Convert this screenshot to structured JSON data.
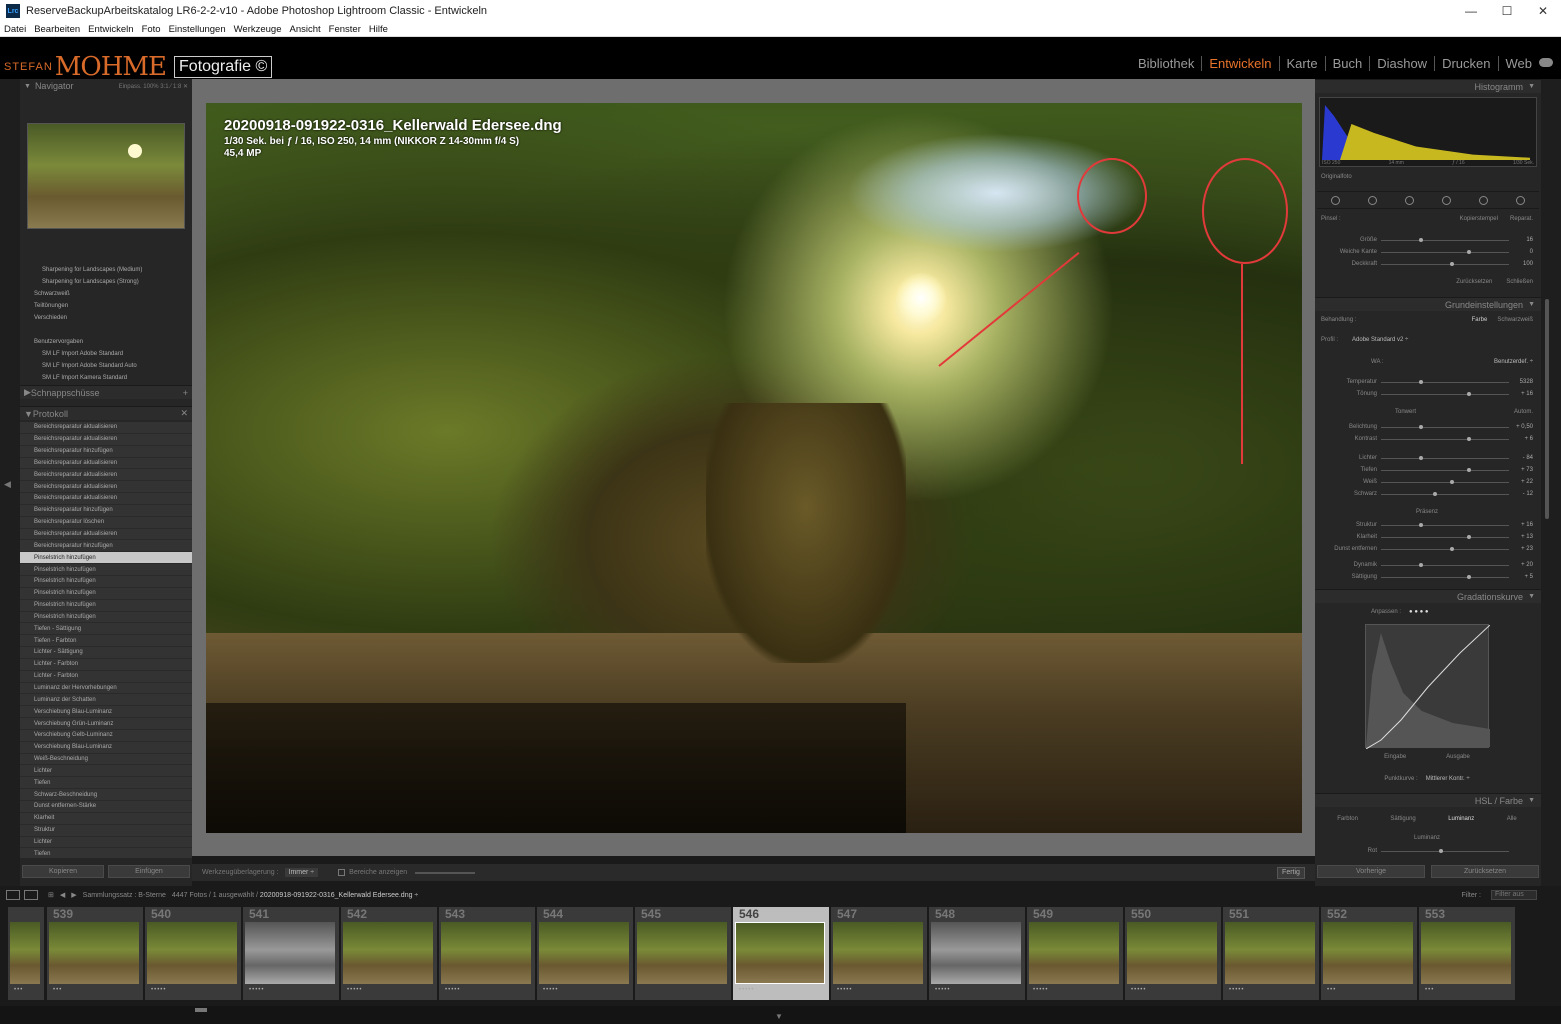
{
  "window": {
    "title": "ReserveBackupArbeitskatalog LR6-2-2-v10 - Adobe Photoshop Lightroom Classic - Entwickeln",
    "app_icon": "Lrc",
    "minimize": "—",
    "maximize": "☐",
    "close": "✕"
  },
  "menu": [
    "Datei",
    "Bearbeiten",
    "Entwickeln",
    "Foto",
    "Einstellungen",
    "Werkzeuge",
    "Ansicht",
    "Fenster",
    "Hilfe"
  ],
  "identity": {
    "stefan": "STEFAN",
    "mohme": "MOHME",
    "fotografie": "Fotografie ©"
  },
  "modules": {
    "items": [
      "Bibliothek",
      "Entwickeln",
      "Karte",
      "Buch",
      "Diashow",
      "Drucken",
      "Web"
    ],
    "active": "Entwickeln",
    "active_color": "#e8732b"
  },
  "left": {
    "navigator": {
      "title": "Navigator",
      "options": "Einpass.  100%  3:1 ⁄ 1:8  ✕"
    },
    "presets": [
      "Sharpening for Landscapes (Medium)",
      "Sharpening for Landscapes (Strong)",
      "Schwarzweiß",
      "Teiltönungen",
      "Verschieden",
      "",
      "Benutzervorgaben",
      "SM LF Import Adobe Standard",
      "SM LF Import Adobe Standard Auto",
      "SM LF Import Kamera Standard"
    ],
    "snapshots": {
      "title": "Schnappschüsse",
      "add": "+"
    },
    "history": {
      "title": "Protokoll",
      "clear": "✕",
      "items": [
        {
          "label": "Bereichsreparatur aktualisieren",
          "value": ""
        },
        {
          "label": "Bereichsreparatur aktualisieren",
          "value": ""
        },
        {
          "label": "Bereichsreparatur hinzufügen",
          "value": ""
        },
        {
          "label": "Bereichsreparatur aktualisieren",
          "value": ""
        },
        {
          "label": "Bereichsreparatur aktualisieren",
          "value": ""
        },
        {
          "label": "Bereichsreparatur aktualisieren",
          "value": ""
        },
        {
          "label": "Bereichsreparatur aktualisieren",
          "value": ""
        },
        {
          "label": "Bereichsreparatur hinzufügen",
          "value": ""
        },
        {
          "label": "Bereichsreparatur löschen",
          "value": ""
        },
        {
          "label": "Bereichsreparatur aktualisieren",
          "value": ""
        },
        {
          "label": "Bereichsreparatur hinzufügen",
          "value": ""
        },
        {
          "label": "Pinselstrich hinzufügen",
          "value": "",
          "selected": true
        },
        {
          "label": "Pinselstrich hinzufügen",
          "value": ""
        },
        {
          "label": "Pinselstrich hinzufügen",
          "value": ""
        },
        {
          "label": "Pinselstrich hinzufügen",
          "value": ""
        },
        {
          "label": "Pinselstrich hinzufügen",
          "value": ""
        },
        {
          "label": "Pinselstrich hinzufügen",
          "value": ""
        },
        {
          "label": "Tiefen - Sättigung",
          "value": ""
        },
        {
          "label": "Tiefen - Farbton",
          "value": ""
        },
        {
          "label": "Lichter - Sättigung",
          "value": ""
        },
        {
          "label": "Lichter - Farbton",
          "value": ""
        },
        {
          "label": "Lichter - Farbton",
          "value": ""
        },
        {
          "label": "Luminanz der Hervorhebungen",
          "value": ""
        },
        {
          "label": "Luminanz der Schatten",
          "value": ""
        },
        {
          "label": "Verschiebung Blau-Luminanz",
          "value": ""
        },
        {
          "label": "Verschiebung Grün-Luminanz",
          "value": ""
        },
        {
          "label": "Verschiebung Gelb-Luminanz",
          "value": ""
        },
        {
          "label": "Verschiebung Blau-Luminanz",
          "value": ""
        },
        {
          "label": "Weiß-Beschneidung",
          "value": ""
        },
        {
          "label": "Lichter",
          "value": ""
        },
        {
          "label": "Tiefen",
          "value": ""
        },
        {
          "label": "Schwarz-Beschneidung",
          "value": ""
        },
        {
          "label": "Dunst entfernen-Stärke",
          "value": ""
        },
        {
          "label": "Klarheit",
          "value": ""
        },
        {
          "label": "Struktur",
          "value": ""
        },
        {
          "label": "Lichter",
          "value": ""
        },
        {
          "label": "Tiefen",
          "value": ""
        }
      ]
    },
    "buttons": {
      "copy": "Kopieren",
      "paste": "Einfügen"
    }
  },
  "photo": {
    "filename": "20200918-091922-0316_Kellerwald Edersee.dng",
    "exif": "1/30 Sek. bei ƒ / 16, ISO 250, 14 mm (NIKKOR Z 14-30mm f/4 S)",
    "megapixels": "45,4 MP"
  },
  "toolbar": {
    "overlay_label": "Werkzeugüberlagerung :",
    "overlay_value": "Immer ÷",
    "show_spots": "Bereiche anzeigen",
    "done": "Fertig"
  },
  "right": {
    "histogram": {
      "title": "Histogramm",
      "stats": [
        "ISO 250",
        "14 mm",
        "ƒ / 16",
        "1/30 Sek."
      ],
      "original": "Originalfoto"
    },
    "spot": {
      "pinsel": "Pinsel :",
      "clone": "Kopierstempel",
      "heal": "Reparat.",
      "rows": [
        {
          "label": "Größe",
          "value": "16"
        },
        {
          "label": "Weiche Kante",
          "value": "0"
        },
        {
          "label": "Deckkraft",
          "value": "100"
        }
      ],
      "reset": "Zurücksetzen",
      "close": "Schließen"
    },
    "basic": {
      "title": "Grundeinstellungen",
      "treatment_label": "Behandlung :",
      "color": "Farbe",
      "bw": "Schwarzweiß",
      "profile_label": "Profil :",
      "profile_value": "Adobe Standard v2 ÷",
      "wb_label": "WA :",
      "wb_value": "Benutzerdef. ÷",
      "wb_rows": [
        {
          "label": "Temperatur",
          "value": "5328"
        },
        {
          "label": "Tönung",
          "value": "+ 16"
        }
      ],
      "tone_label": "Tonwert",
      "auto": "Autom.",
      "tone_rows": [
        {
          "label": "Belichtung",
          "value": "+ 0,50"
        },
        {
          "label": "Kontrast",
          "value": "+ 6"
        }
      ],
      "tone_rows2": [
        {
          "label": "Lichter",
          "value": "- 84"
        },
        {
          "label": "Tiefen",
          "value": "+ 73"
        },
        {
          "label": "Weiß",
          "value": "+ 22"
        },
        {
          "label": "Schwarz",
          "value": "- 12"
        }
      ],
      "presence_label": "Präsenz",
      "presence_rows": [
        {
          "label": "Struktur",
          "value": "+ 16"
        },
        {
          "label": "Klarheit",
          "value": "+ 13"
        },
        {
          "label": "Dunst entfernen",
          "value": "+ 23"
        }
      ],
      "presence_rows2": [
        {
          "label": "Dynamik",
          "value": "+ 20"
        },
        {
          "label": "Sättigung",
          "value": "+ 5"
        }
      ]
    },
    "tonecurve": {
      "title": "Gradationskurve",
      "channel": "Anpassen :",
      "input": "Eingabe",
      "output": "Ausgabe",
      "point_curve_label": "Punktkurve :",
      "point_curve_value": "Mittlerer Kontr. ÷"
    },
    "hsl": {
      "title": "HSL / Farbe",
      "tabs": [
        "Farbton",
        "Sättigung",
        "Luminanz",
        "Alle"
      ],
      "active": "Luminanz",
      "luminanz": "Luminanz",
      "rot": "Rot"
    },
    "buttons": {
      "previous": "Vorherige",
      "reset": "Zurücksetzen"
    }
  },
  "filmstrip": {
    "source": "Sammlungssatz : B-Sterne",
    "count": "4447 Fotos / 1 ausgewählt /",
    "current": "20200918-091922-0316_Kellerwald Edersee.dng ÷",
    "filter_label": "Filter :",
    "filter_value": "Filter aus",
    "cells": [
      {
        "num": "",
        "dots": "•••",
        "bw": false
      },
      {
        "num": "539",
        "dots": "•••",
        "bw": false
      },
      {
        "num": "540",
        "dots": "•••••",
        "bw": false
      },
      {
        "num": "541",
        "dots": "•••••",
        "bw": true
      },
      {
        "num": "542",
        "dots": "•••••",
        "bw": false
      },
      {
        "num": "543",
        "dots": "•••••",
        "bw": false
      },
      {
        "num": "544",
        "dots": "•••••",
        "bw": false
      },
      {
        "num": "545",
        "dots": "",
        "bw": false
      },
      {
        "num": "546",
        "dots": "•••••",
        "bw": false,
        "selected": true
      },
      {
        "num": "547",
        "dots": "•••••",
        "bw": false
      },
      {
        "num": "548",
        "dots": "•••••",
        "bw": true
      },
      {
        "num": "549",
        "dots": "•••••",
        "bw": false
      },
      {
        "num": "550",
        "dots": "•••••",
        "bw": false
      },
      {
        "num": "551",
        "dots": "•••••",
        "bw": false
      },
      {
        "num": "552",
        "dots": "•••",
        "bw": false
      },
      {
        "num": "553",
        "dots": "•••",
        "bw": false
      }
    ]
  }
}
